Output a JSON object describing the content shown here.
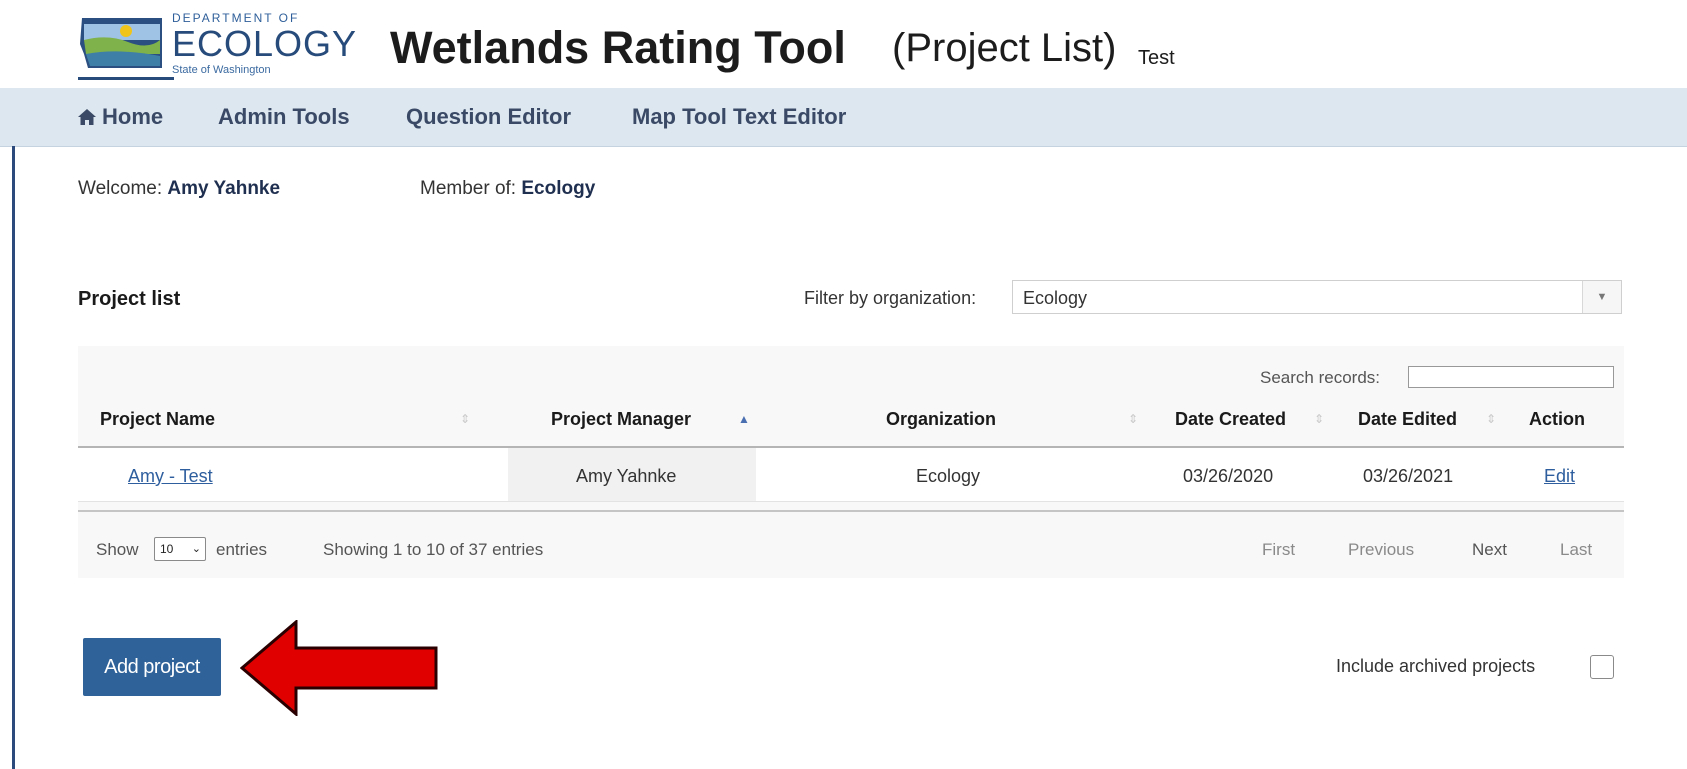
{
  "header": {
    "logo": {
      "department": "DEPARTMENT OF",
      "name": "ECOLOGY",
      "state": "State of Washington",
      "icon": "washington-state-map-icon"
    },
    "app_title": "Wetlands Rating Tool",
    "page_subtitle": "(Project List)",
    "environment": "Test"
  },
  "nav": {
    "items": [
      {
        "label": "Home",
        "icon": "home-icon"
      },
      {
        "label": "Admin Tools"
      },
      {
        "label": "Question Editor"
      },
      {
        "label": "Map Tool Text Editor"
      }
    ]
  },
  "user": {
    "welcome_label": "Welcome:",
    "name": "Amy Yahnke",
    "member_label": "Member of:",
    "organization": "Ecology"
  },
  "project_list": {
    "title": "Project list",
    "filter_label": "Filter by organization:",
    "filter_value": "Ecology",
    "search_label": "Search records:",
    "search_value": "",
    "columns": [
      "Project Name",
      "Project Manager",
      "Organization",
      "Date Created",
      "Date Edited",
      "Action"
    ],
    "rows": [
      {
        "project_name": "Amy - Test",
        "project_manager": "Amy Yahnke",
        "organization": "Ecology",
        "date_created": "03/26/2020",
        "date_edited": "03/26/2021",
        "action": "Edit"
      }
    ],
    "length_label_before": "Show",
    "length_value": "10",
    "length_label_after": "entries",
    "info": "Showing 1 to 10 of 37 entries",
    "pagination": [
      "First",
      "Previous",
      "Next",
      "Last"
    ]
  },
  "actions": {
    "add_project": "Add project",
    "include_archived_label": "Include archived projects",
    "include_archived_checked": false
  },
  "colors": {
    "nav_background": "#dde7f0",
    "primary_button": "#2f6299",
    "link": "#2e5e9e",
    "annotation_arrow": "#e00000"
  }
}
